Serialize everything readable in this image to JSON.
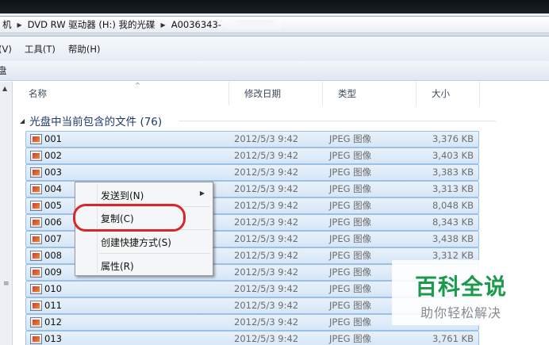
{
  "address": {
    "crumbs": [
      "机",
      "DVD RW 驱动器 (H:) 我的光碟",
      "A0036343-"
    ]
  },
  "menubar": [
    "(V)",
    "工具(T)",
    "帮助(H)"
  ],
  "toolbar": {
    "label": "盘"
  },
  "columns": {
    "name": "名称",
    "date": "修改日期",
    "type": "类型",
    "size": "大小"
  },
  "group": {
    "label": "光盘中当前包含的文件 (76)"
  },
  "files": [
    {
      "name": "001",
      "date": "2012/5/3 9:42",
      "type": "JPEG 图像",
      "size": "3,376 KB"
    },
    {
      "name": "002",
      "date": "2012/5/3 9:42",
      "type": "JPEG 图像",
      "size": "3,403 KB"
    },
    {
      "name": "003",
      "date": "2012/5/3 9:42",
      "type": "JPEG 图像",
      "size": "3,383 KB"
    },
    {
      "name": "004",
      "date": "2012/5/3 9:42",
      "type": "JPEG 图像",
      "size": "3,313 KB"
    },
    {
      "name": "005",
      "date": "2012/5/3 9:42",
      "type": "JPEG 图像",
      "size": "8,048 KB"
    },
    {
      "name": "006",
      "date": "2012/5/3 9:42",
      "type": "JPEG 图像",
      "size": "8,343 KB"
    },
    {
      "name": "007",
      "date": "2012/5/3 9:42",
      "type": "JPEG 图像",
      "size": "3,438 KB"
    },
    {
      "name": "008",
      "date": "2012/5/3 9:42",
      "type": "JPEG 图像",
      "size": "3,312 KB"
    },
    {
      "name": "009",
      "date": "2012/5/3 9:42",
      "type": "JPEG 图像",
      "size": ""
    },
    {
      "name": "010",
      "date": "2012/5/3 9:42",
      "type": "JPEG 图像",
      "size": ""
    },
    {
      "name": "011",
      "date": "2012/5/3 9:42",
      "type": "JPEG 图像",
      "size": ""
    },
    {
      "name": "012",
      "date": "2012/5/3 9:42",
      "type": "JPEG 图像",
      "size": ""
    },
    {
      "name": "013",
      "date": "2012/5/3 9:42",
      "type": "JPEG 图像",
      "size": "3,761 KB"
    }
  ],
  "context_menu": {
    "send_to": "发送到(N)",
    "copy": "复制(C)",
    "create_shortcut": "创建快捷方式(S)",
    "properties": "属性(R)"
  },
  "watermark": {
    "title": "百科全说",
    "subtitle": "助你轻松解决"
  },
  "colors": {
    "selection": "#d6e6f7",
    "highlight_ring": "#d9262b",
    "watermark": "#1a9a4a"
  }
}
